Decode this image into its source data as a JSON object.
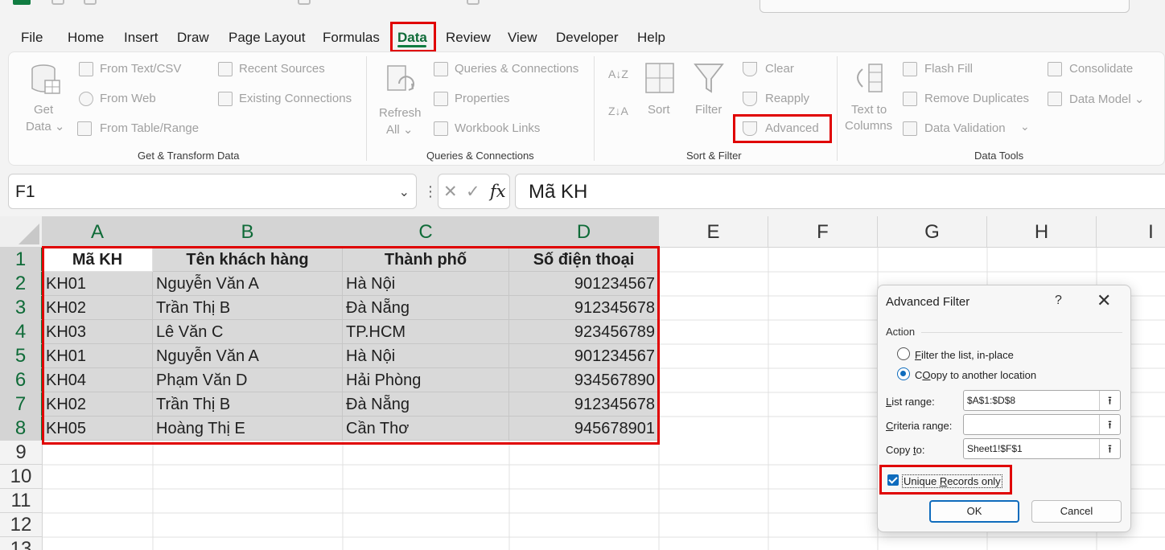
{
  "menu": {
    "tabs": [
      "File",
      "Home",
      "Insert",
      "Draw",
      "Page Layout",
      "Formulas",
      "Data",
      "Review",
      "View",
      "Developer",
      "Help"
    ],
    "active_tab": "Data"
  },
  "ribbon": {
    "get_data": {
      "line1": "Get",
      "line2": "Data ⌄"
    },
    "get_transform": [
      "From Text/CSV",
      "From Web",
      "From Table/Range",
      "Recent Sources",
      "Existing Connections"
    ],
    "refresh": {
      "line1": "Refresh",
      "line2": "All ⌄"
    },
    "queries": [
      "Queries & Connections",
      "Properties",
      "Workbook Links"
    ],
    "sort_az": "A↓Z",
    "sort_za": "Z↓A",
    "sort": "Sort",
    "filter": "Filter",
    "clear": "Clear",
    "reapply": "Reapply",
    "advanced": "Advanced",
    "text_to_columns": {
      "line1": "Text to",
      "line2": "Columns"
    },
    "data_tools": [
      "Flash Fill",
      "Remove Duplicates",
      "Data Validation"
    ],
    "consolidate": "Consolidate",
    "data_model": "Data Model ⌄",
    "groups": [
      "Get & Transform Data",
      "Queries & Connections",
      "Sort & Filter",
      "Data Tools"
    ]
  },
  "formula_bar": {
    "name_box": "F1",
    "formula": "Mã KH"
  },
  "grid": {
    "columns": [
      "A",
      "B",
      "C",
      "D",
      "E",
      "F",
      "G",
      "H",
      "I"
    ],
    "rows": [
      "1",
      "2",
      "3",
      "4",
      "5",
      "6",
      "7",
      "8",
      "9",
      "10",
      "11",
      "12",
      "13"
    ],
    "header": [
      "Mã KH",
      "Tên khách hàng",
      "Thành phố",
      "Số điện thoại"
    ],
    "data": [
      [
        "KH01",
        "Nguyễn Văn A",
        "Hà Nội",
        "901234567"
      ],
      [
        "KH02",
        "Trần Thị B",
        "Đà Nẵng",
        "912345678"
      ],
      [
        "KH03",
        "Lê Văn C",
        "TP.HCM",
        "923456789"
      ],
      [
        "KH01",
        "Nguyễn Văn A",
        "Hà Nội",
        "901234567"
      ],
      [
        "KH04",
        "Phạm Văn D",
        "Hải Phòng",
        "934567890"
      ],
      [
        "KH02",
        "Trần Thị B",
        "Đà Nẵng",
        "912345678"
      ],
      [
        "KH05",
        "Hoàng Thị E",
        "Cần Thơ",
        "945678901"
      ]
    ]
  },
  "dialog": {
    "title": "Advanced Filter",
    "help": "?",
    "close": "✕",
    "action_label": "Action",
    "filter_in_place": {
      "key": "F",
      "rest": "ilter the list, in-place"
    },
    "copy_to_location": {
      "key": "O",
      "rest": "opy to another location",
      "prefix": "C"
    },
    "list_range": {
      "key": "L",
      "rest": "ist range:",
      "value": "$A$1:$D$8"
    },
    "criteria_range": {
      "key": "C",
      "rest": "riteria range:",
      "value": ""
    },
    "copy_to": {
      "before": "Copy ",
      "key": "t",
      "rest": "o:",
      "value": "Sheet1!$F$1"
    },
    "unique": {
      "key": "R",
      "before": "Unique ",
      "rest": "ecords only"
    },
    "ok": "OK",
    "cancel": "Cancel",
    "selected_action": "copy"
  },
  "colors": {
    "excel_green": "#107c41",
    "highlight_red": "#e00000",
    "accent_blue": "#0f6cbd",
    "selection_gray": "#d9d9d9"
  }
}
